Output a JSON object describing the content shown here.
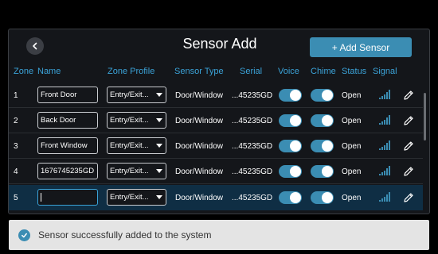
{
  "header": {
    "title": "Sensor Add",
    "add_button_label": "+ Add Sensor"
  },
  "columns": {
    "zone": "Zone",
    "name": "Name",
    "zone_profile": "Zone Profile",
    "sensor_type": "Sensor Type",
    "serial": "Serial",
    "voice": "Voice",
    "chime": "Chime",
    "status": "Status",
    "signal": "Signal"
  },
  "rows": [
    {
      "zone": "1",
      "name": "Front Door",
      "profile": "Entry/Exit...",
      "type": "Door/Window",
      "serial": "...45235GD",
      "voice": true,
      "chime": true,
      "status": "Open"
    },
    {
      "zone": "2",
      "name": "Back Door",
      "profile": "Entry/Exit...",
      "type": "Door/Window",
      "serial": "...45235GD",
      "voice": true,
      "chime": true,
      "status": "Open"
    },
    {
      "zone": "3",
      "name": "Front Window",
      "profile": "Entry/Exit...",
      "type": "Door/Window",
      "serial": "...45235GD",
      "voice": true,
      "chime": true,
      "status": "Open"
    },
    {
      "zone": "4",
      "name": "1676745235GD",
      "profile": "Entry/Exit...",
      "type": "Door/Window",
      "serial": "...45235GD",
      "voice": true,
      "chime": true,
      "status": "Open"
    },
    {
      "zone": "5",
      "name": "",
      "profile": "Entry/Exit...",
      "type": "Door/Window",
      "serial": "...45235GD",
      "voice": true,
      "chime": true,
      "status": "Open"
    }
  ],
  "toast": {
    "message": "Sensor successfully added to the system"
  },
  "colors": {
    "accent": "#3b8db3",
    "header_text": "#3ba3d8",
    "selected_row": "#0f2e44",
    "background": "#14161a"
  }
}
